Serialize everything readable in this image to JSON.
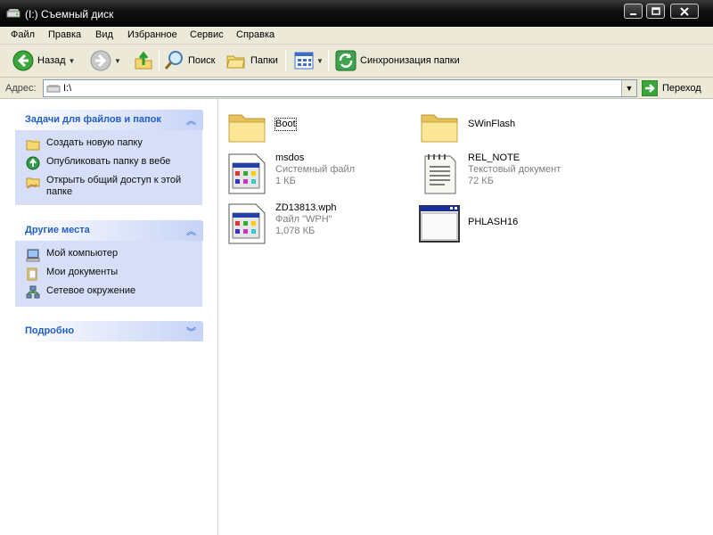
{
  "window": {
    "title": "(I:) Съемный диск"
  },
  "menu": [
    "Файл",
    "Правка",
    "Вид",
    "Избранное",
    "Сервис",
    "Справка"
  ],
  "toolbar": {
    "back": "Назад",
    "search": "Поиск",
    "folders": "Папки",
    "sync": "Синхронизация папки"
  },
  "address": {
    "label": "Адрес:",
    "path": "I:\\",
    "go": "Переход"
  },
  "tasks": {
    "title": "Задачи для файлов и папок",
    "items": [
      {
        "label": "Создать новую папку",
        "icon": "new-folder-icon"
      },
      {
        "label": "Опубликовать папку в вебе",
        "icon": "publish-web-icon"
      },
      {
        "label": "Открыть общий доступ к этой папке",
        "icon": "share-folder-icon"
      }
    ]
  },
  "places": {
    "title": "Другие места",
    "items": [
      {
        "label": "Мой компьютер",
        "icon": "my-computer-icon"
      },
      {
        "label": "Мои документы",
        "icon": "my-documents-icon"
      },
      {
        "label": "Сетевое окружение",
        "icon": "network-icon"
      }
    ]
  },
  "details": {
    "title": "Подробно"
  },
  "files": [
    {
      "name": "Boot",
      "icon": "folder-icon"
    },
    {
      "name": "SWinFlash",
      "icon": "folder-icon"
    },
    {
      "name": "msdos",
      "type": "Системный файл",
      "size": "1 КБ",
      "icon": "system-file-icon"
    },
    {
      "name": "REL_NOTE",
      "type": "Текстовый документ",
      "size": "72 КБ",
      "icon": "text-document-icon"
    },
    {
      "name": "ZD13813.wph",
      "type": "Файл \"WPH\"",
      "size": "1,078 КБ",
      "icon": "system-file-icon"
    },
    {
      "name": "PHLASH16",
      "icon": "application-icon"
    }
  ],
  "colors": {
    "panel_title": "#215dc6",
    "panel_body": "#d6dff7",
    "secondary_text": "#7f7f7f"
  }
}
